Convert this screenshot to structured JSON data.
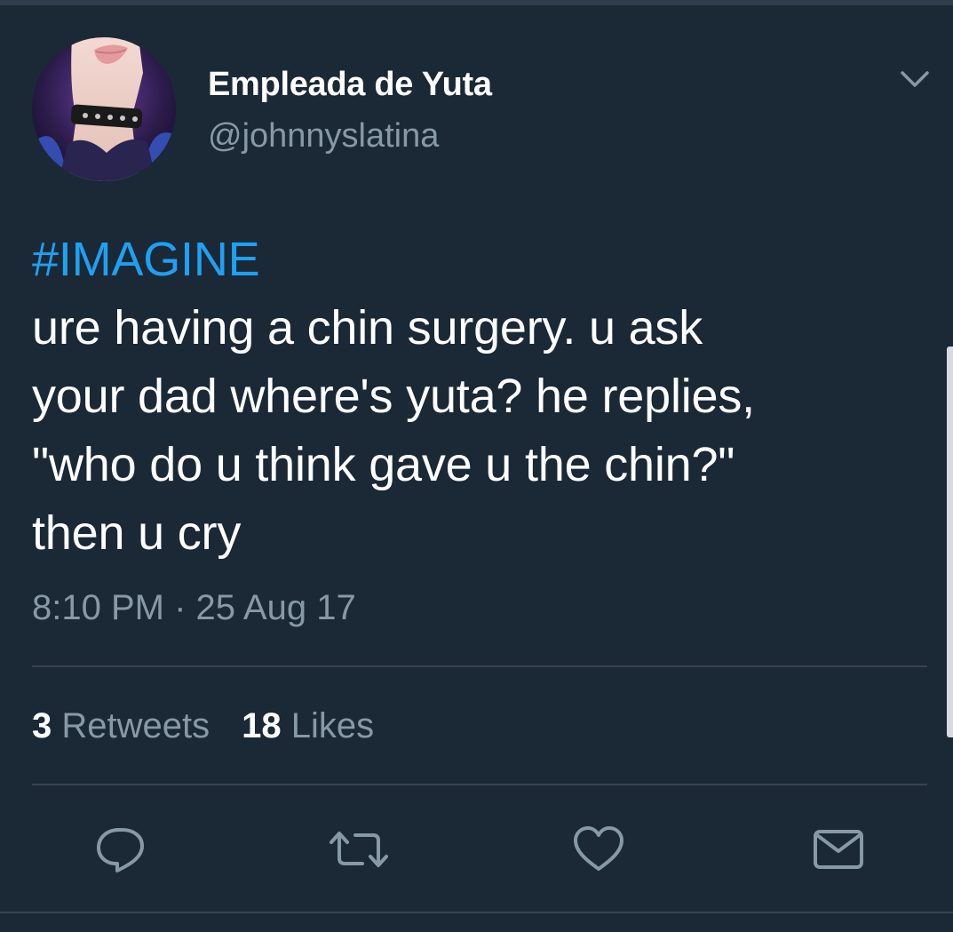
{
  "tweet": {
    "author": {
      "display_name": "Empleada de Yuta",
      "handle": "@johnnyslatina"
    },
    "hashtag": "#IMAGINE",
    "text_lines": [
      "ure having a chin surgery. u ask",
      "your dad where's yuta? he replies,",
      "\"who do u think gave u the chin?\"",
      "then u cry"
    ],
    "timestamp": "8:10 PM · 25 Aug 17",
    "stats": {
      "retweets_count": "3",
      "retweets_label": "Retweets",
      "likes_count": "18",
      "likes_label": "Likes"
    }
  },
  "actions": [
    "reply-icon",
    "retweet-icon",
    "like-icon",
    "share-icon"
  ],
  "colors": {
    "background": "#1b2836",
    "hashtag": "#1da1f2",
    "secondary_text": "#8899a6",
    "divider": "#38444d"
  }
}
